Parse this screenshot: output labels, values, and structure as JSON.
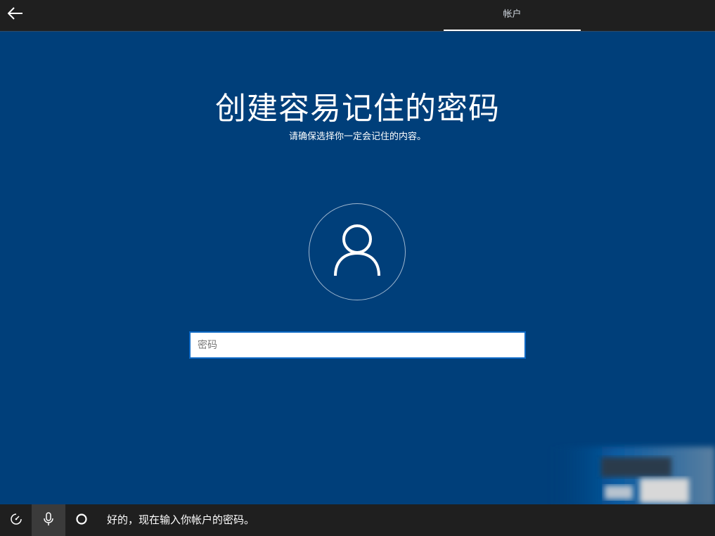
{
  "header": {
    "back_icon": "arrow-left-icon",
    "tab_label": "帐户"
  },
  "main": {
    "title": "创建容易记住的密码",
    "subtitle": "请确保选择你一定会记住的内容。",
    "avatar_icon": "user-icon",
    "password_placeholder": "密码",
    "password_value": ""
  },
  "footer": {
    "accessibility_icon": "ease-of-access-icon",
    "mic_icon": "microphone-icon",
    "cortana_icon": "cortana-circle-icon",
    "cortana_text": "好的，现在输入你帐户的密码。"
  },
  "colors": {
    "background": "#003f7a",
    "bar": "#1f1f1f",
    "input_border": "#0b68c4"
  }
}
